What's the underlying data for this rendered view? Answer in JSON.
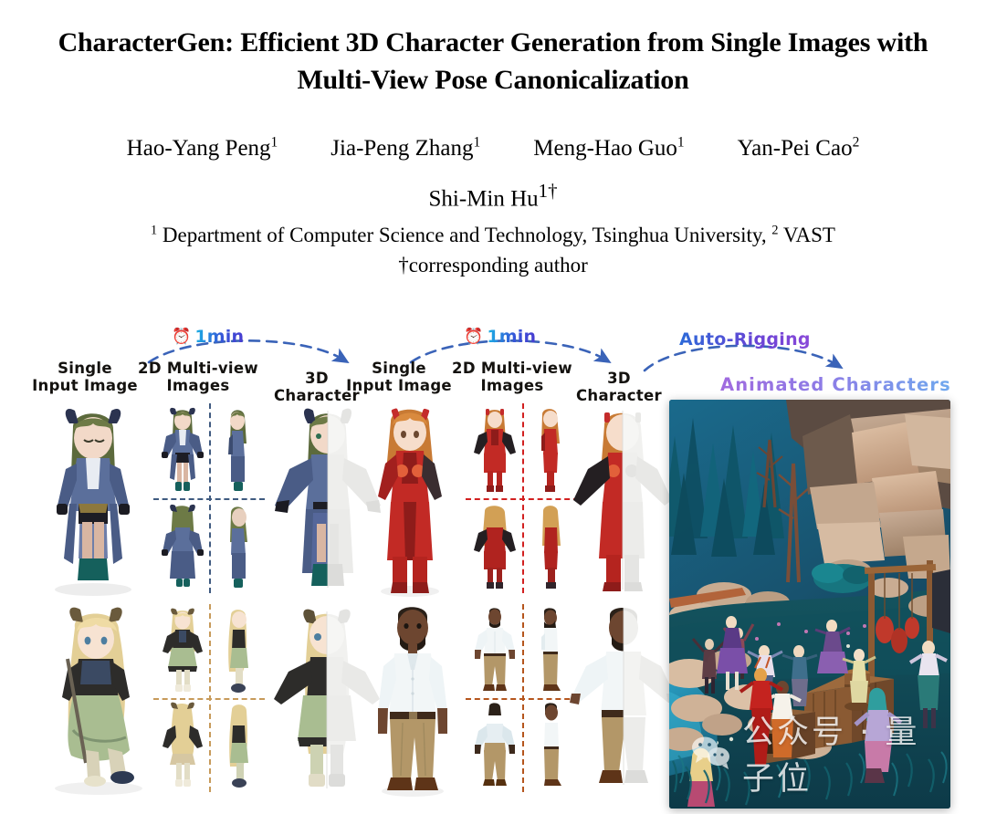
{
  "paper": {
    "title_line1": "CharacterGen: Efficient 3D Character Generation from Single Images with",
    "title_line2": "Multi-View Pose Canonicalization",
    "authors": [
      {
        "name": "Hao-Yang Peng",
        "sup": "1"
      },
      {
        "name": "Jia-Peng Zhang",
        "sup": "1"
      },
      {
        "name": "Meng-Hao Guo",
        "sup": "1"
      },
      {
        "name": "Yan-Pei Cao",
        "sup": "2"
      }
    ],
    "author_last": {
      "name": "Shi-Min Hu",
      "sup": "1†"
    },
    "affiliation_prefix": "1",
    "affiliation_text": " Department of Computer Science and Technology, Tsinghua University, ",
    "affiliation_sup2": "2",
    "affiliation_suffix": " VAST",
    "corresponding": "†corresponding author"
  },
  "figure": {
    "pipelines": [
      {
        "id": "pipeline-left",
        "stage_input": "Single\nInput Image",
        "stage_multiview": "2D Multi-view\nImages",
        "stage_3d": "3D Character",
        "time_badge": "1min",
        "clock_icon": "alarm-clock-icon"
      },
      {
        "id": "pipeline-right",
        "stage_input": "Single\nInput Image",
        "stage_multiview": "2D Multi-view\nImages",
        "stage_3d": "3D Character",
        "time_badge": "1min",
        "clock_icon": "alarm-clock-icon"
      }
    ],
    "rigging_label": "Auto-Rigging",
    "animated_label": "Animated Characters",
    "divider_colors": {
      "row1_left": "#3f5a80",
      "row1_right": "#d22020",
      "row2_left": "#c79a5a",
      "row2_right": "#b5551d"
    },
    "arrow_color": "#3a63b8",
    "accent_cyan": "#19b4e4",
    "accent_purple": "#8a49d8"
  },
  "watermark": {
    "icon": "wechat-icon",
    "text": "公众号 · 量子位"
  }
}
